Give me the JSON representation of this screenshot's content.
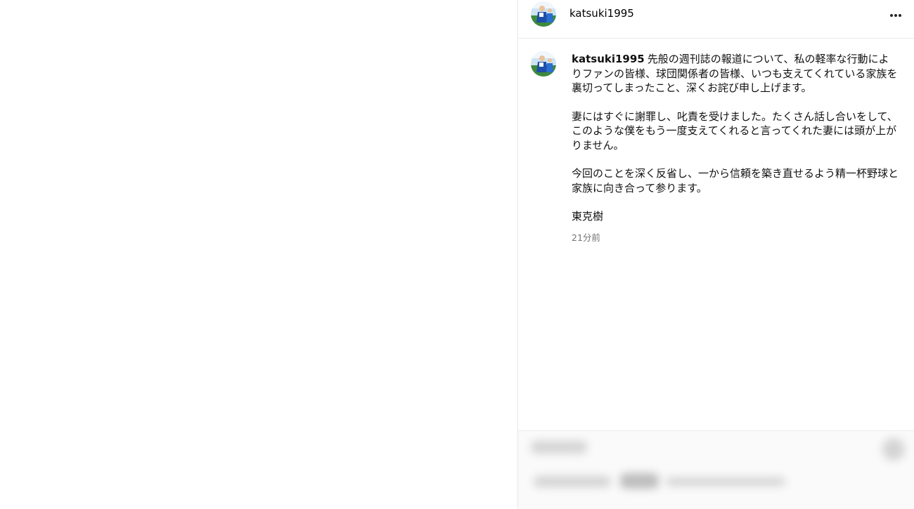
{
  "post": {
    "username": "katsuki1995",
    "more_icon": "more-horizontal-icon",
    "avatar_icon": "profile-photo-icon",
    "caption": {
      "author": "katsuki1995",
      "paragraph1": "先般の週刊誌の報道について、私の軽率な行動によりファンの皆様、球団関係者の皆様、いつも支えてくれている家族を裏切ってしまったこと、深くお詫び申し上げます。",
      "paragraph2": "妻にはすぐに謝罪し、叱責を受けました。たくさん話し合いをして、このような僕をもう一度支えてくれると言ってくれた妻には頭が上がりません。",
      "paragraph3": "今回のことを深く反省し、一から信頼を築き直せるよう精一杯野球と家族に向き合って参ります。",
      "signature": "東克樹"
    },
    "timestamp": "21分前"
  },
  "colors": {
    "text": "#000000",
    "muted": "#737373",
    "border": "#e6e6e6",
    "avatar_bg": "#2a6fd1"
  }
}
